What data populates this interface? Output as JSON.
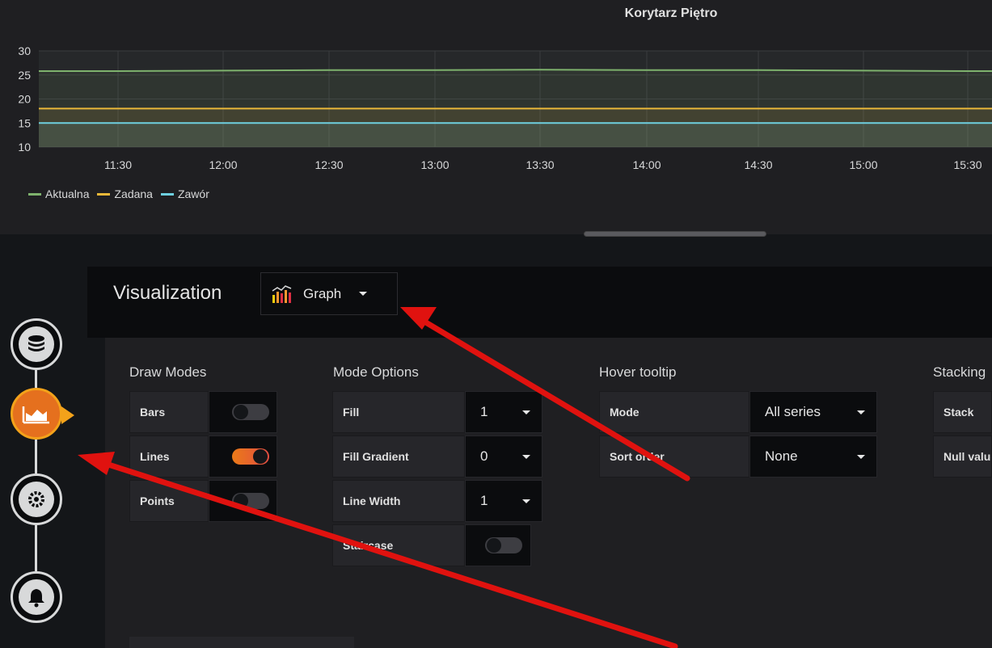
{
  "chart": {
    "title": "Korytarz Piętro",
    "y_ticks": [
      "30",
      "25",
      "20",
      "15",
      "10"
    ],
    "x_ticks": [
      "11:30",
      "12:00",
      "12:30",
      "13:00",
      "13:30",
      "14:00",
      "14:30",
      "15:00",
      "15:30"
    ],
    "legend": [
      {
        "name": "Aktualna",
        "color": "#7eb26d"
      },
      {
        "name": "Zadana",
        "color": "#eab839"
      },
      {
        "name": "Zawór",
        "color": "#6ed0e0"
      }
    ]
  },
  "chart_data": {
    "type": "line",
    "title": "Korytarz Piętro",
    "xlabel": "",
    "ylabel": "",
    "ylim": [
      10,
      30
    ],
    "x": [
      "11:30",
      "12:00",
      "12:30",
      "13:00",
      "13:30",
      "14:00",
      "14:30",
      "15:00",
      "15:30"
    ],
    "grid": true,
    "legend_position": "bottom-left",
    "fill": true,
    "series": [
      {
        "name": "Aktualna",
        "color": "#7eb26d",
        "values": [
          25.8,
          25.9,
          26.0,
          26.0,
          26.1,
          26.0,
          26.0,
          25.9,
          25.8
        ]
      },
      {
        "name": "Zadana",
        "color": "#eab839",
        "values": [
          18,
          18,
          18,
          18,
          18,
          18,
          18,
          18,
          18
        ]
      },
      {
        "name": "Zawór",
        "color": "#6ed0e0",
        "values": [
          15,
          15,
          15,
          15,
          15,
          15,
          15,
          15,
          15
        ]
      }
    ]
  },
  "visualization": {
    "title": "Visualization",
    "selected": "Graph",
    "icon": "graph-icon"
  },
  "draw_modes": {
    "title": "Draw Modes",
    "items": [
      {
        "label": "Bars",
        "on": false
      },
      {
        "label": "Lines",
        "on": true
      },
      {
        "label": "Points",
        "on": false
      }
    ]
  },
  "mode_options": {
    "title": "Mode Options",
    "fill_label": "Fill",
    "fill_value": "1",
    "gradient_label": "Fill Gradient",
    "gradient_value": "0",
    "linewidth_label": "Line Width",
    "linewidth_value": "1",
    "staircase_label": "Staircase",
    "staircase_on": false
  },
  "hover_tooltip": {
    "title": "Hover tooltip",
    "mode_label": "Mode",
    "mode_value": "All series",
    "sort_label": "Sort order",
    "sort_value": "None"
  },
  "stacking": {
    "title": "Stacking",
    "stack_label": "Stack",
    "null_label": "Null value"
  },
  "rail": {
    "steps": [
      "database-icon",
      "chart-icon",
      "settings-icon",
      "bell-icon"
    ],
    "active": "chart-icon"
  },
  "annotation_color": "#e0120f"
}
